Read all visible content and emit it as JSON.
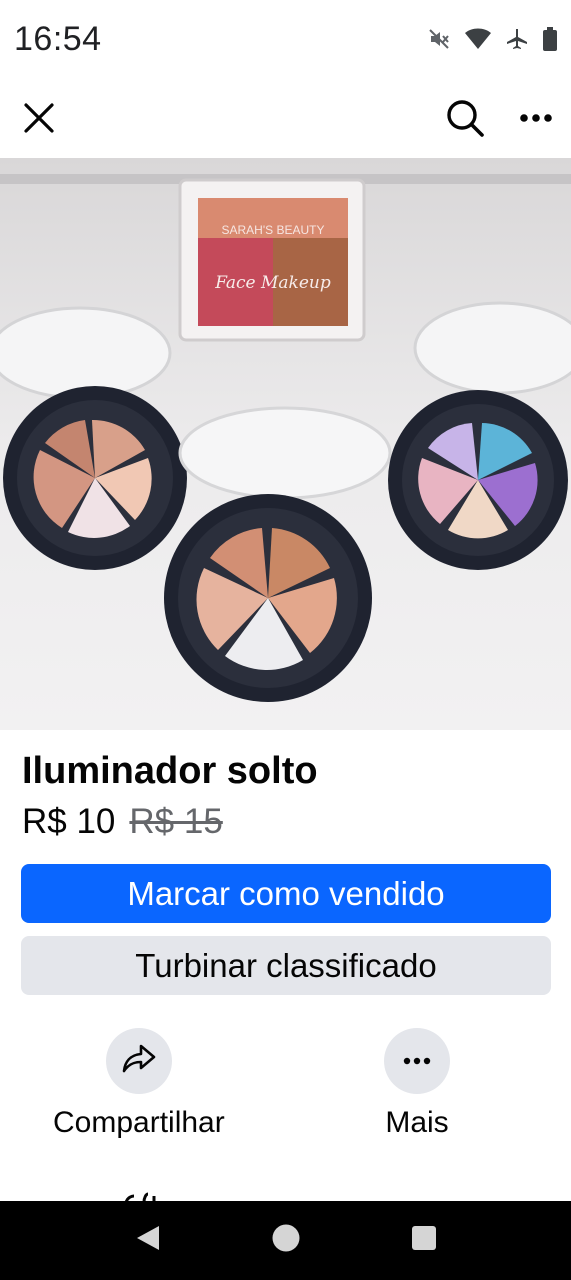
{
  "status_bar": {
    "time": "16:54",
    "icons": [
      "mute-icon",
      "wifi-icon",
      "airplane-icon",
      "battery-icon"
    ]
  },
  "top_bar": {
    "icons": [
      "close-icon",
      "search-icon",
      "more-icon"
    ]
  },
  "listing": {
    "title": "Iluminador solto",
    "price": "R$ 10",
    "original_price": "R$ 15"
  },
  "buttons": {
    "mark_sold": "Marcar como vendido",
    "boost": "Turbinar classificado"
  },
  "actions": [
    {
      "label": "Compartilhar",
      "icon": "share-icon"
    },
    {
      "label": "Mais",
      "icon": "more-icon"
    }
  ],
  "colors": {
    "primary": "#0a66ff",
    "secondary_bg": "#e4e6eb",
    "text": "#050505",
    "muted": "#65676b"
  }
}
